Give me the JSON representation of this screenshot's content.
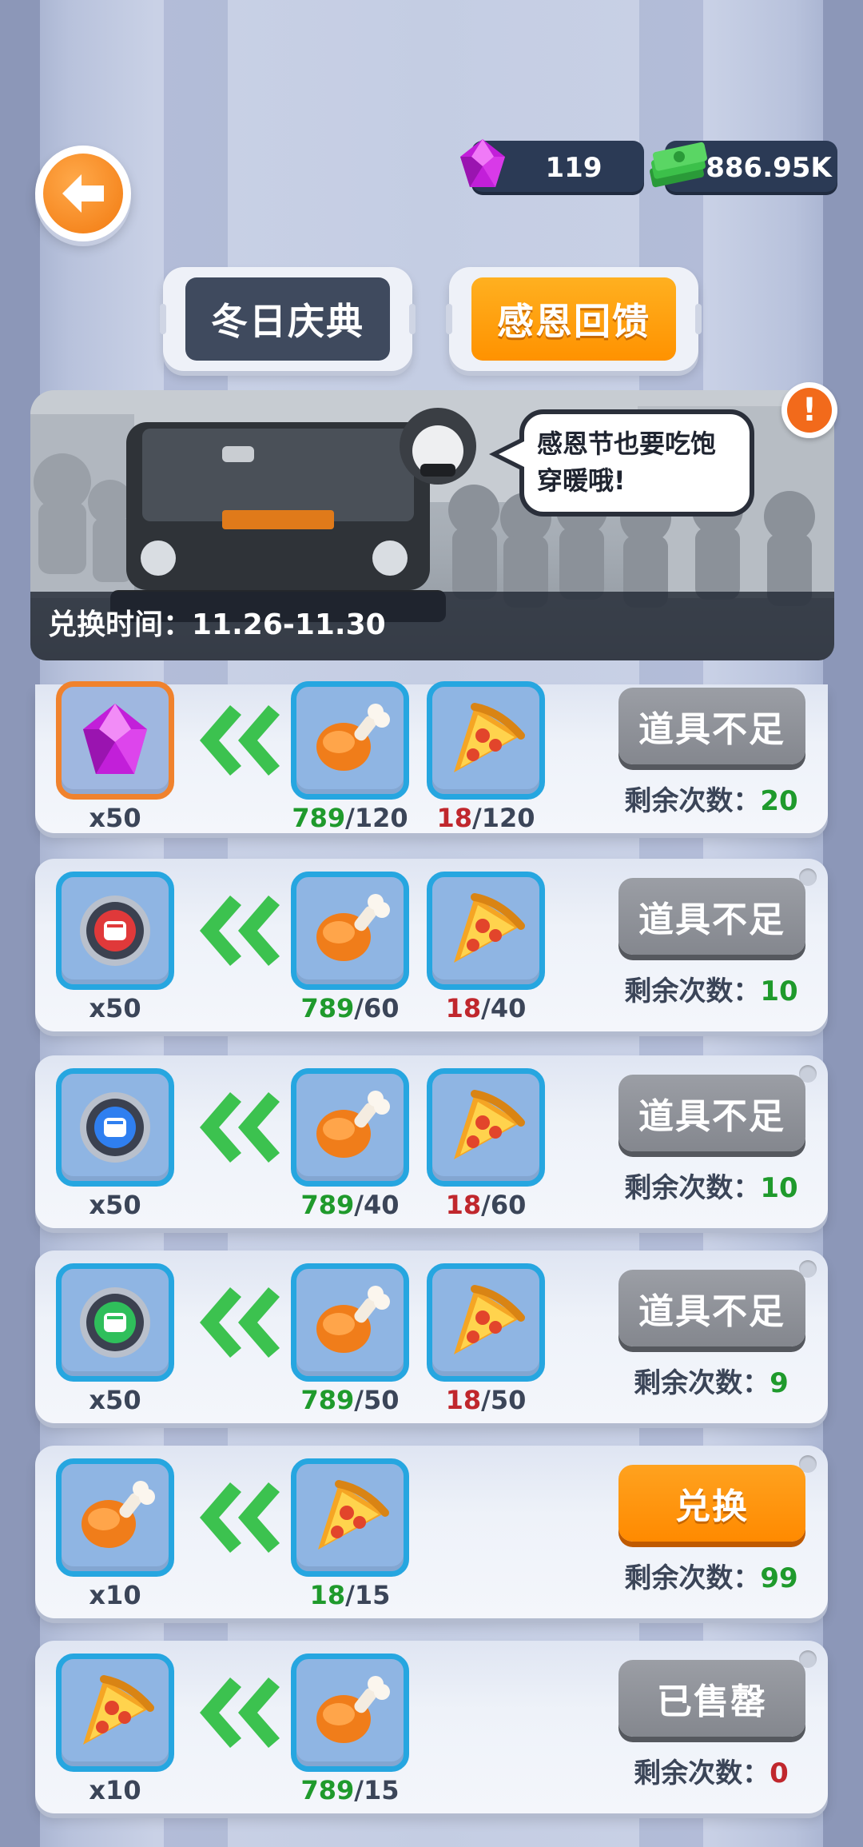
{
  "currency": {
    "gems": "119",
    "cash": "886.95K"
  },
  "tabs": [
    {
      "label": "冬日庆典",
      "active": false
    },
    {
      "label": "感恩回馈",
      "active": true
    }
  ],
  "banner": {
    "speech": "感恩节也要吃饱穿暖哦!",
    "time_text": "兑换时间：11.26-11.30"
  },
  "remaining_label": "剩余次数：",
  "colors": {
    "accent_orange": "#ff9200",
    "have_green": "#1f9a2c",
    "need_red": "#c0272d",
    "slot_blue": "#26a6e0"
  },
  "offers": [
    {
      "reward_icon": "gem-icon",
      "reward_qty": "x50",
      "costs": [
        {
          "icon": "drumstick-icon",
          "have": "789",
          "need": "/120",
          "enough": true
        },
        {
          "icon": "pizza-icon",
          "have": "18",
          "need": "/120",
          "enough": false
        }
      ],
      "button": "道具不足",
      "button_style": "gray",
      "remaining": "20"
    },
    {
      "reward_icon": "red-fist-token-icon",
      "reward_qty": "x50",
      "costs": [
        {
          "icon": "drumstick-icon",
          "have": "789",
          "need": "/60",
          "enough": true
        },
        {
          "icon": "pizza-icon",
          "have": "18",
          "need": "/40",
          "enough": false
        }
      ],
      "button": "道具不足",
      "button_style": "gray",
      "remaining": "10"
    },
    {
      "reward_icon": "blue-fist-token-icon",
      "reward_qty": "x50",
      "costs": [
        {
          "icon": "drumstick-icon",
          "have": "789",
          "need": "/40",
          "enough": true
        },
        {
          "icon": "pizza-icon",
          "have": "18",
          "need": "/60",
          "enough": false
        }
      ],
      "button": "道具不足",
      "button_style": "gray",
      "remaining": "10"
    },
    {
      "reward_icon": "green-fist-token-icon",
      "reward_qty": "x50",
      "costs": [
        {
          "icon": "drumstick-icon",
          "have": "789",
          "need": "/50",
          "enough": true
        },
        {
          "icon": "pizza-icon",
          "have": "18",
          "need": "/50",
          "enough": false
        }
      ],
      "button": "道具不足",
      "button_style": "gray",
      "remaining": "9"
    },
    {
      "reward_icon": "drumstick-icon",
      "reward_qty": "x10",
      "costs": [
        {
          "icon": "pizza-icon",
          "have": "18",
          "need": "/15",
          "enough": true
        }
      ],
      "button": "兑换",
      "button_style": "orange",
      "remaining": "99"
    },
    {
      "reward_icon": "pizza-icon",
      "reward_qty": "x10",
      "costs": [
        {
          "icon": "drumstick-icon",
          "have": "789",
          "need": "/15",
          "enough": true
        }
      ],
      "button": "已售罄",
      "button_style": "gray",
      "remaining": "0"
    }
  ]
}
